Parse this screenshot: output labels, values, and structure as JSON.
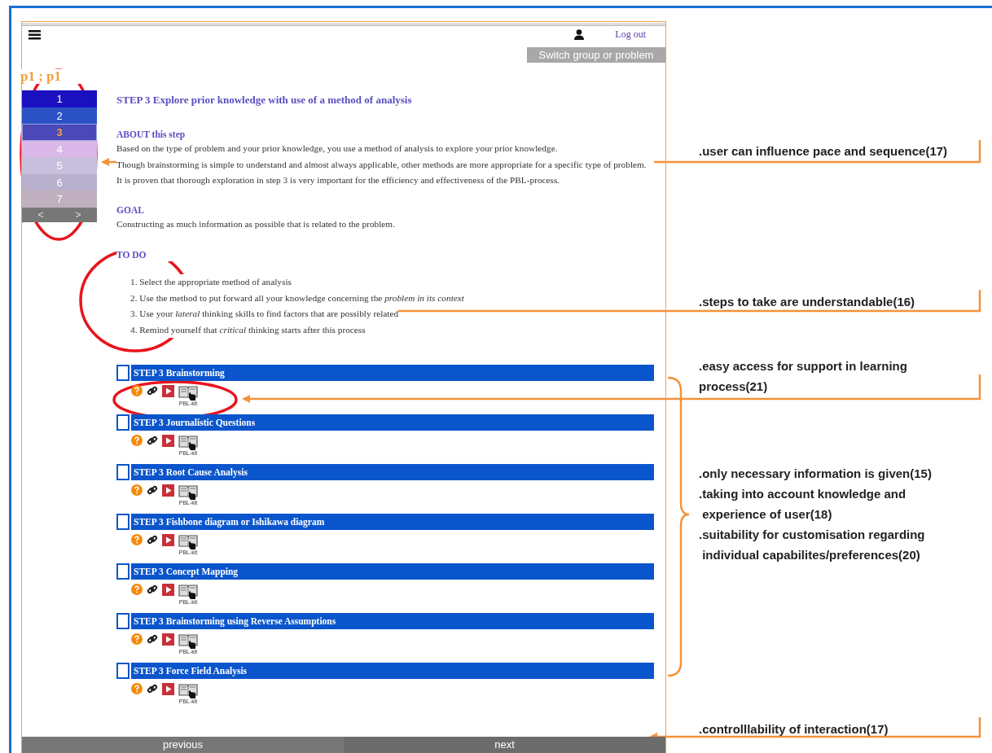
{
  "header": {
    "logout": "Log out",
    "switch_button": "Switch group or problem"
  },
  "context_label": "p1 ; p1",
  "step_nav": {
    "items": [
      {
        "label": "1",
        "color": "#1a10c0",
        "selected": false
      },
      {
        "label": "2",
        "color": "#2a52c4",
        "selected": false
      },
      {
        "label": "3",
        "color": "#4b48b8",
        "selected": true
      },
      {
        "label": "4",
        "color": "#dbb8ea",
        "selected": false
      },
      {
        "label": "5",
        "color": "#c8c0dc",
        "selected": false
      },
      {
        "label": "6",
        "color": "#b8b0cc",
        "selected": false
      },
      {
        "label": "7",
        "color": "#c0b0c0",
        "selected": false
      }
    ],
    "prev": "<",
    "next": ">"
  },
  "content": {
    "title": "STEP 3 Explore prior knowledge with use of a method of analysis",
    "about_heading": "ABOUT this step",
    "about_paragraphs": [
      "Based on the type of problem and your prior knowledge, you use a method of analysis to explore your prior knowledge.",
      "Though brainstorming is simple to understand and almost always applicable, other methods are more appropriate for a specific type of problem.  It is proven that thorough exploration in step 3 is very important for the efficiency and effectiveness of the PBL-process."
    ],
    "goal_heading": "GOAL",
    "goal_text": "Constructing as much information as possible that is related to the problem.",
    "todo_heading": "TO DO",
    "todo_items": [
      "1. Select the appropriate method of analysis",
      "2. Use the method to put forward all your knowledge concerning the *problem in its context*",
      "3. Use your *lateral* thinking skills to find factors that are possibly related",
      "4. Remind yourself that *critical* thinking starts after this process"
    ]
  },
  "methods": [
    {
      "title": "STEP 3 Brainstorming",
      "checked": false,
      "caption": "PBL-kit"
    },
    {
      "title": "STEP 3 Journalistic Questions",
      "checked": false,
      "caption": "PBL-kit"
    },
    {
      "title": "STEP 3 Root Cause Analysis",
      "checked": false,
      "caption": "PBL-kit"
    },
    {
      "title": "STEP 3 Fishbone diagram or Ishikawa diagram",
      "checked": false,
      "caption": "PBL-kit"
    },
    {
      "title": "STEP 3 Concept Mapping",
      "checked": false,
      "caption": "PBL-kit"
    },
    {
      "title": "STEP 3 Brainstorming using Reverse Assumptions",
      "checked": false,
      "caption": "PBL-kit"
    },
    {
      "title": "STEP 3 Force Field Analysis",
      "checked": false,
      "caption": "PBL-kit"
    }
  ],
  "footer": {
    "previous": "previous",
    "next": "next"
  },
  "annotations": [
    {
      "texts": [
        ".user can influence pace and sequence(17)"
      ]
    },
    {
      "texts": [
        ".steps to take are understandable(16)"
      ]
    },
    {
      "texts": [
        ".easy access for support in learning\nprocess(21)"
      ]
    },
    {
      "texts": [
        ".only necessary information is given(15)",
        ".taking into account knowledge and\n experience of user(18)",
        ".suitability for customisation regarding\n individual capabilites/preferences(20)"
      ]
    },
    {
      "texts": [
        ".controlllability of interaction(17)"
      ]
    }
  ]
}
